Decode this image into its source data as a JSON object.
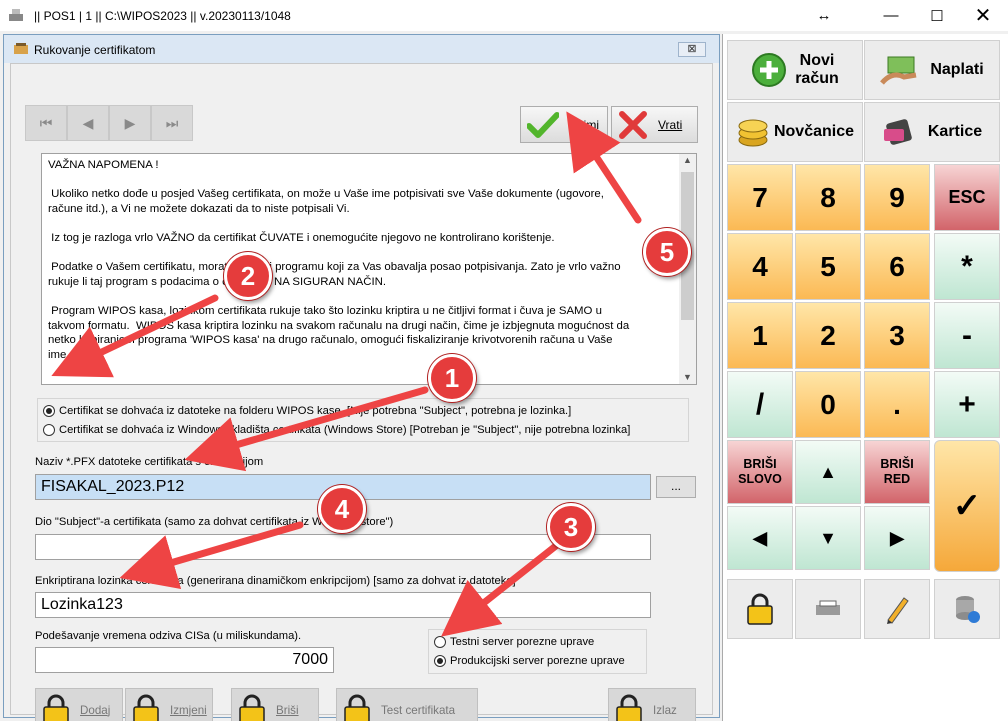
{
  "window": {
    "title": "|| POS1 | 1 || C:\\WIPOS2023 || v.20230113/1048"
  },
  "dialog": {
    "title": "Rukovanje certifikatom",
    "close_label": "⊠",
    "save_label": "Snimi",
    "back_label": "Vrati",
    "note_text": "VAŽNA NAPOMENA !\n\n Ukoliko netko dođe u posjed Vašeg certifikata, on može u Vaše ime potpisivati sve Vaše dokumente (ugovore,\nračune itd.), a Vi ne možete dokazati da to niste potpisali Vi.\n\n Iz tog je razloga vrlo VAŽNO da certifikat ČUVATE i onemogućite njegovo ne kontrolirano korištenje.\n\n Podatke o Vašem certifikatu, morate predati programu koji za Vas obavalja posao potpisivanja. Zato je vrlo važno\nrukuje li taj program s podacima o certifikatu NA SIGURAN NAČIN.\n\n Program WIPOS kasa, lozinkom certifikata rukuje tako što lozinku kriptira u ne čitljivi format i čuva je SAMO u\ntakvom formatu.  WIPOS kasa kriptira lozinku na svakom računalu na drugi način, čime je izbjegnuta mogućnost da\nnetko kopiranjem programa 'WIPOS kasa' na drugo računalo, omogući fiskaliziranje krivotvorenih računa u Vaše\nime.",
    "cert_source": [
      {
        "label": "Certifikat se dohvaća iz datoteke na folderu WIPOS kase. [Nije potrebna \"Subject\", potrebna je lozinka.]",
        "selected": true
      },
      {
        "label": "Certifikat se dohvaća iz Windows skladišta certifikata (Windows Store) [Potreban je \"Subject\", nije potrebna lozinka]",
        "selected": false
      }
    ],
    "pfx_label": "Naziv *.PFX datoteke certifikata s ekstenzijom",
    "pfx_value": "FISAKAL_2023.P12",
    "browse_label": "...",
    "subject_label": "Dio \"Subject\"-a certifikata (samo za dohvat certifikata iz Windows store\")",
    "subject_value": "",
    "password_label": "Enkriptirana lozinka certifikata (generirana dinamičkom enkripcijom) [samo za dohvat iz datoteke]",
    "password_value": "Lozinka123",
    "timeout_label": "Podešavanje vremena odziva CISa (u miliskundama).",
    "timeout_value": "7000",
    "server": [
      {
        "label": "Testni server porezne uprave",
        "selected": false
      },
      {
        "label": "Produkcijski server porezne uprave",
        "selected": true
      }
    ],
    "buttons": {
      "add": "Dodaj",
      "edit": "Izmjeni",
      "delete": "Briši",
      "test": "Test certifikata",
      "exit": "Izlaz"
    }
  },
  "keypad": {
    "new_receipt": "Novi\nračun",
    "pay": "Naplati",
    "banknotes": "Novčanice",
    "cards": "Kartice",
    "keys": [
      "7",
      "8",
      "9",
      "ESC",
      "4",
      "5",
      "6",
      "*",
      "1",
      "2",
      "3",
      "-",
      "/",
      "0",
      ".",
      "+"
    ],
    "delete_char": "BRIŠI\nSLOVO",
    "delete_row": "BRIŠI\nRED",
    "ok": "✓"
  },
  "badges": [
    "1",
    "2",
    "3",
    "4",
    "5"
  ],
  "colors": {
    "badge": "#e53c3c",
    "pfx_field": "#c7dff5",
    "key_orange": "#fbb954",
    "key_green": "#bfe6d2",
    "key_red": "#d2646a"
  }
}
